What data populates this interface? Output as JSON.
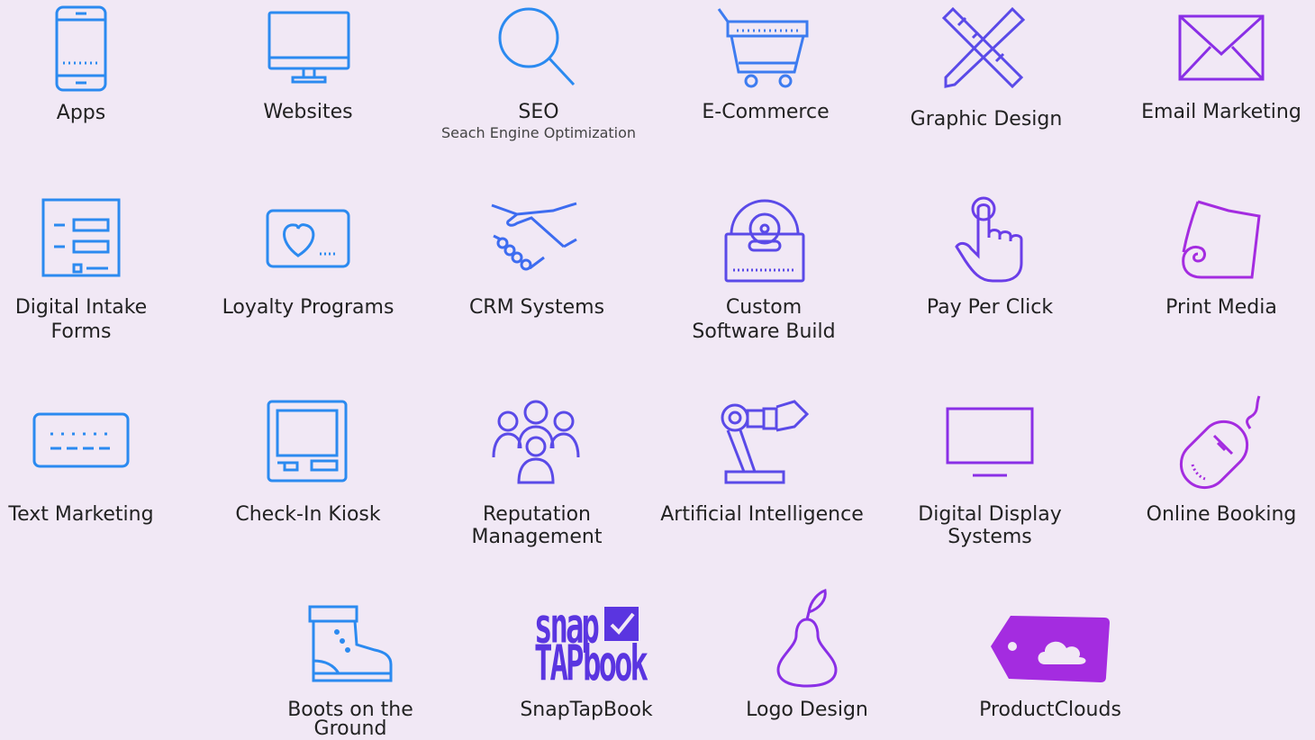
{
  "tiles": [
    {
      "label": "Apps",
      "sublabel": ""
    },
    {
      "label": "Websites",
      "sublabel": ""
    },
    {
      "label": "SEO",
      "sublabel": "Seach Engine Optimization"
    },
    {
      "label": "E-Commerce",
      "sublabel": ""
    },
    {
      "label": "Graphic Design",
      "sublabel": ""
    },
    {
      "label": "Email Marketing",
      "sublabel": ""
    },
    {
      "label": "Digital Intake",
      "label2": "Forms"
    },
    {
      "label": "Loyalty Programs"
    },
    {
      "label": "CRM Systems"
    },
    {
      "label": "Custom",
      "label2": "Software Build"
    },
    {
      "label": "Pay Per Click"
    },
    {
      "label": "Print Media"
    },
    {
      "label": "Text Marketing"
    },
    {
      "label": "Check-In Kiosk"
    },
    {
      "label": "Reputation",
      "label2": "Management"
    },
    {
      "label": "Artificial Intelligence"
    },
    {
      "label": "Digital Display",
      "label2": "Systems"
    },
    {
      "label": "Online Booking"
    },
    {
      "label": "Boots on the",
      "label2": "Ground"
    },
    {
      "label": "SnapTapBook"
    },
    {
      "label": "Logo Design"
    },
    {
      "label": "ProductClouds"
    }
  ],
  "logo_text": {
    "snap": "snap",
    "tap": "TAP",
    "book": "book"
  },
  "colors": {
    "background": "#f1e8f5",
    "blue": "#2b8af0",
    "indigo": "#5a4ae8",
    "purple": "#8a2fe6",
    "magenta": "#a42ce0"
  }
}
